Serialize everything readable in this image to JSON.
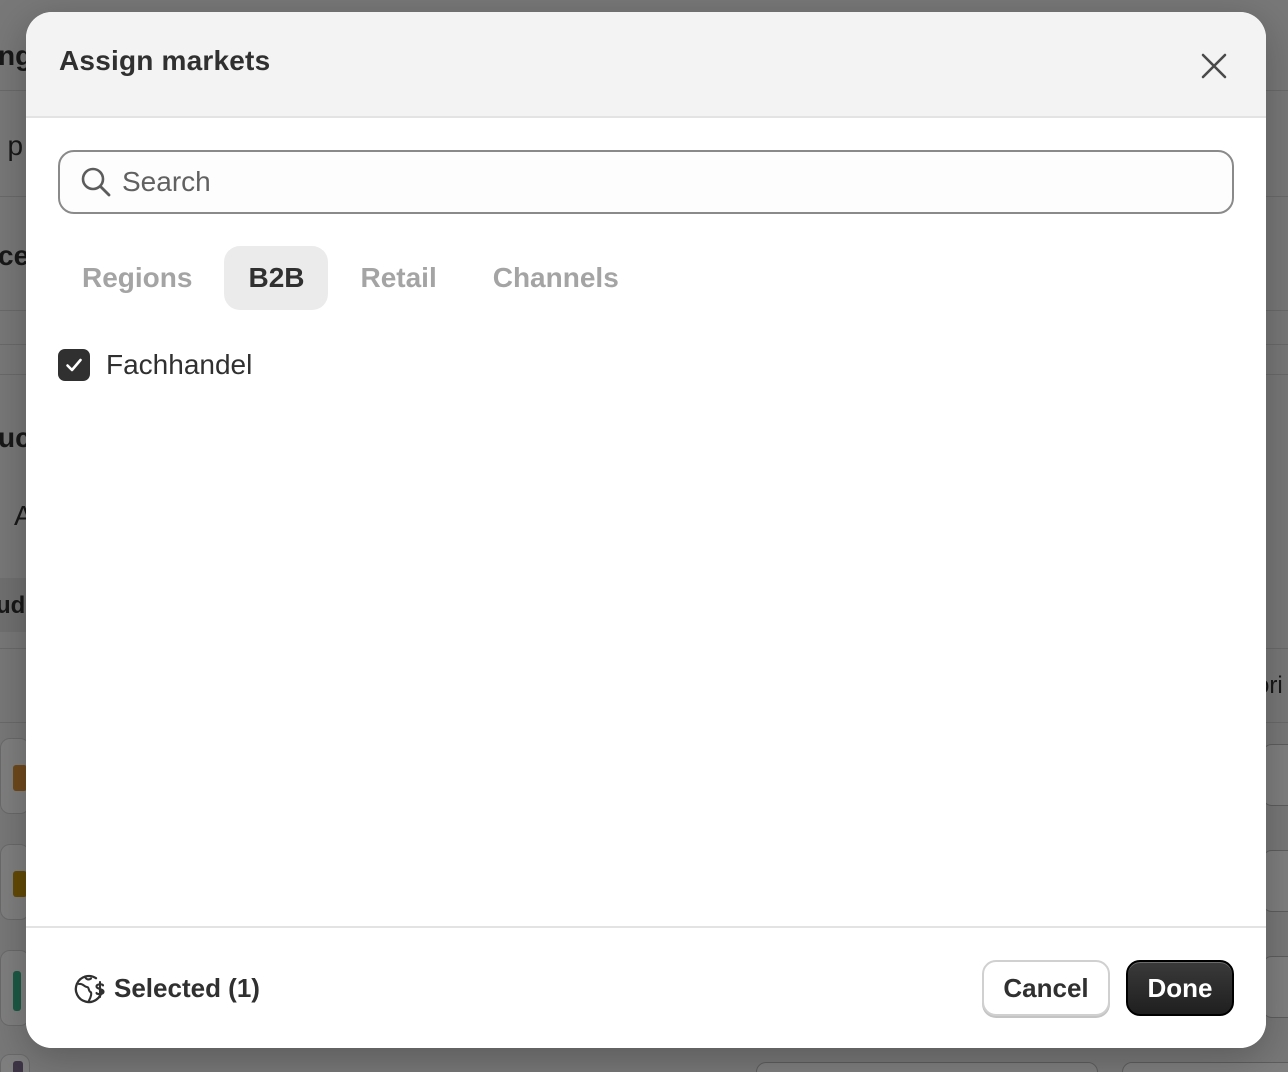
{
  "background": {
    "fragments": [
      "ng",
      "t p",
      "ce",
      "uc",
      "A",
      "ude",
      "ori"
    ]
  },
  "modal": {
    "title": "Assign markets",
    "search": {
      "placeholder": "Search",
      "value": ""
    },
    "tabs": [
      {
        "label": "Regions",
        "active": false
      },
      {
        "label": "B2B",
        "active": true
      },
      {
        "label": "Retail",
        "active": false
      },
      {
        "label": "Channels",
        "active": false
      }
    ],
    "items": [
      {
        "label": "Fachhandel",
        "checked": true
      }
    ],
    "footer": {
      "selected_label": "Selected (1)",
      "cancel_label": "Cancel",
      "done_label": "Done"
    }
  },
  "icons": {
    "close": "close-icon",
    "search": "search-icon",
    "checkbox": "checkmark-icon",
    "selected": "globe-currency-icon"
  }
}
